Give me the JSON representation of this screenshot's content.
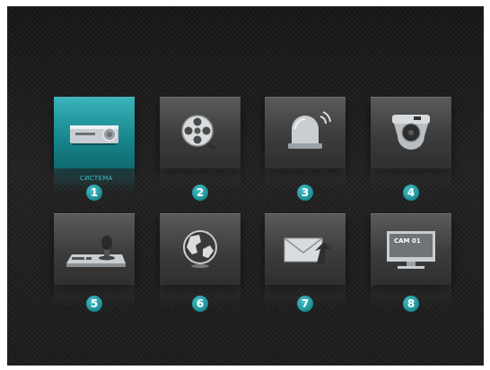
{
  "menu": {
    "selected_label": "СИСТЕМА",
    "items": [
      {
        "number": "1",
        "icon": "dvr-recorder-icon",
        "selected": true
      },
      {
        "number": "2",
        "icon": "film-reel-icon",
        "selected": false
      },
      {
        "number": "3",
        "icon": "alarm-siren-icon",
        "selected": false
      },
      {
        "number": "4",
        "icon": "dome-camera-icon",
        "selected": false
      },
      {
        "number": "5",
        "icon": "ptz-joystick-icon",
        "selected": false
      },
      {
        "number": "6",
        "icon": "globe-network-icon",
        "selected": false
      },
      {
        "number": "7",
        "icon": "email-icon",
        "selected": false
      },
      {
        "number": "8",
        "icon": "monitor-display-icon",
        "selected": false
      }
    ],
    "monitor_text": "CAM 01"
  },
  "colors": {
    "accent": "#1a8b93",
    "selected_tile": "#17858c",
    "tile": "#4a4a4a",
    "background": "#1a1a1a"
  }
}
